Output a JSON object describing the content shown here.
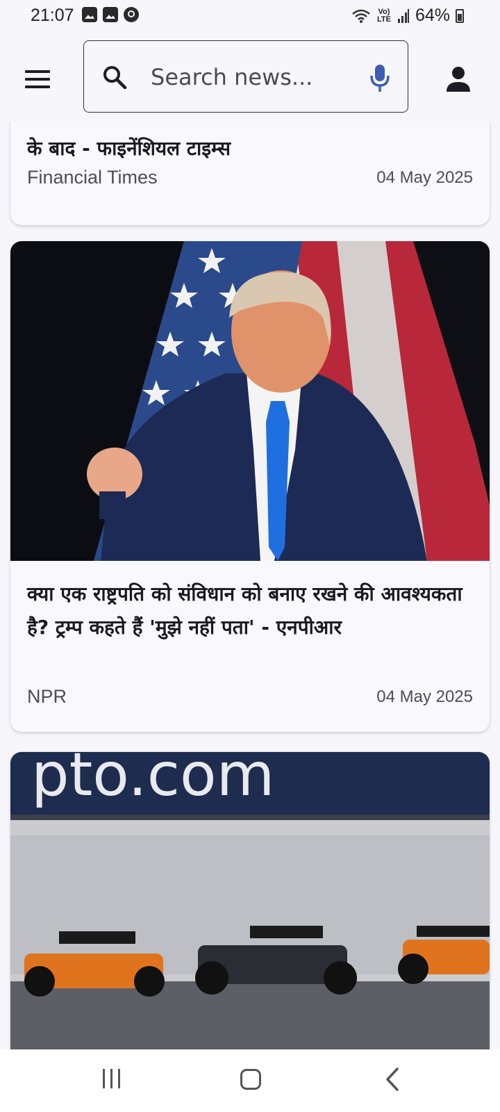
{
  "status_bar": {
    "time": "21:07",
    "network_label": "Vo) LTE",
    "battery": "64%",
    "left_icons": [
      "image-icon",
      "image-icon",
      "messenger-icon"
    ],
    "right_icons": [
      "wifi-icon",
      "volte-icon",
      "signal-icon",
      "battery-icon"
    ]
  },
  "app_bar": {
    "menu_icon": "hamburger-menu-icon",
    "search": {
      "placeholder": "Search news...",
      "value": "",
      "icon": "search-icon",
      "voice_icon": "mic-icon",
      "accent_color": "#3f5db0"
    },
    "account_icon": "account-icon"
  },
  "feed": {
    "articles": [
      {
        "title": "के बाद - फाइनेंशियल टाइम्स",
        "source": "Financial Times",
        "date": "04 May 2025",
        "image": "none"
      },
      {
        "title": "क्या एक राष्ट्रपति को संविधान को बनाए रखने की आवश्यकता है? ट्रम्प कहते हैं 'मुझे नहीं पता' - एनपीआर",
        "source": "NPR",
        "date": "04 May 2025",
        "image": "man-in-suit-fist-pump-american-flag"
      },
      {
        "image": "formula-one-cars-racing",
        "image_banner_text": "pto.com"
      }
    ]
  },
  "nav_bar": {
    "buttons": [
      "recent-apps",
      "home",
      "back"
    ]
  },
  "colors": {
    "background": "#f6f6fb",
    "card": "#f8f8fd",
    "text_primary": "#1a1a1e",
    "text_secondary": "#4d4d55",
    "mic_accent": "#3f5db0"
  }
}
